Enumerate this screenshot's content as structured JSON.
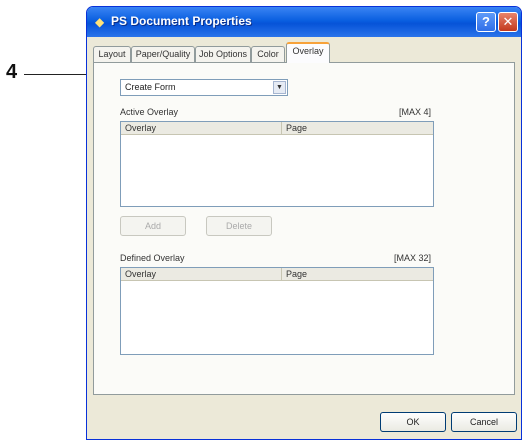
{
  "callout": {
    "number": "4"
  },
  "window": {
    "title": "PS Document Properties",
    "help_symbol": "?",
    "close_symbol": "✕"
  },
  "tabs": [
    {
      "label": "Layout",
      "active": false
    },
    {
      "label": "Paper/Quality",
      "active": false
    },
    {
      "label": "Job Options",
      "active": false
    },
    {
      "label": "Color",
      "active": false
    },
    {
      "label": "Overlay",
      "active": true
    }
  ],
  "overlay_panel": {
    "form_select": {
      "value": "Create Form"
    },
    "active_overlay": {
      "label": "Active Overlay",
      "max": "[MAX 4]",
      "columns": [
        "Overlay",
        "Page"
      ],
      "rows": []
    },
    "add_label": "Add",
    "delete_label": "Delete",
    "defined_overlay": {
      "label": "Defined Overlay",
      "max": "[MAX 32]",
      "columns": [
        "Overlay",
        "Page"
      ],
      "rows": []
    }
  },
  "footer": {
    "ok_label": "OK",
    "cancel_label": "Cancel"
  }
}
